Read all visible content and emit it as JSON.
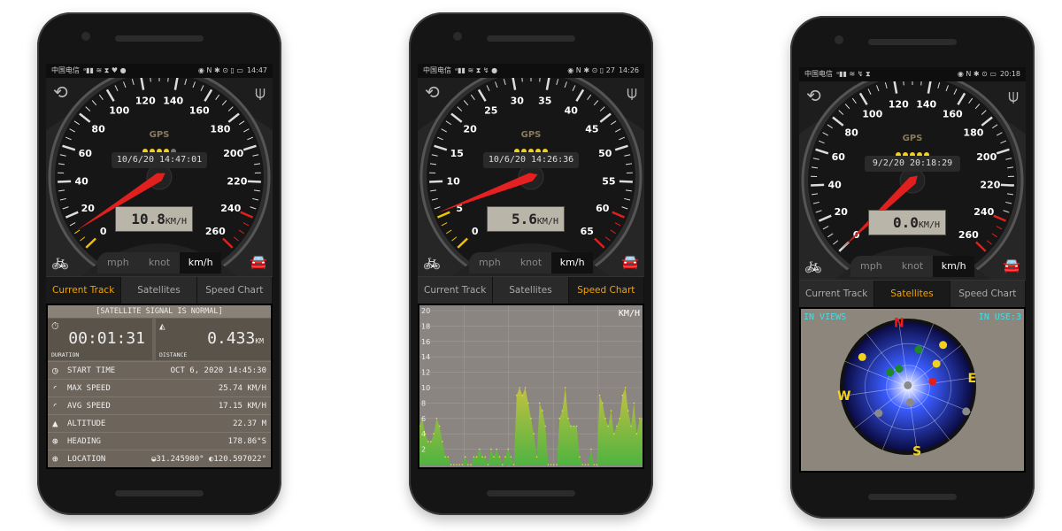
{
  "colors": {
    "accent": "#f2a400",
    "needle": "#e0201f",
    "car": "#9bd81c",
    "lcd": "#b9b5a9"
  },
  "phones": [
    {
      "status": {
        "carrier": "中国电信",
        "icons_left": "ᵃ▮▮ ≋ ⧗ ♥ ●",
        "icons_right": "◉ N ✱ ⊙ ▯ ▭",
        "time": "14:47"
      },
      "gauge": {
        "max": 260,
        "step": 20,
        "ticks": [
          "0",
          "20",
          "40",
          "60",
          "80",
          "100",
          "120",
          "140",
          "160",
          "180",
          "200",
          "220",
          "240",
          "260"
        ],
        "red_from": 240,
        "yellow_to": 10,
        "value": 10.8,
        "gps_label": "GPS",
        "gps_bars": 4,
        "date": "10/6/20 14:47:01",
        "speed": "10.8",
        "speed_unit": "KM/H",
        "units": [
          "mph",
          "knot",
          "km/h"
        ],
        "active_unit": 2
      },
      "tabs": [
        "Current Track",
        "Satellites",
        "Speed Chart"
      ],
      "active_tab": 0,
      "track": {
        "header": "[SATELLITE SIGNAL IS NORMAL]",
        "duration": "00:01:31",
        "duration_label": "DURATION",
        "distance": "0.433",
        "distance_unit": "KM",
        "distance_label": "DISTANCE",
        "rows": [
          {
            "icon": "clock-icon",
            "glyph": "◷",
            "label": "START TIME",
            "value": "OCT 6, 2020 14:45:30"
          },
          {
            "icon": "max-speed-icon",
            "glyph": "◜",
            "label": "MAX SPEED",
            "value": "25.74 KM/H"
          },
          {
            "icon": "avg-speed-icon",
            "glyph": "◜",
            "label": "AVG SPEED",
            "value": "17.15 KM/H"
          },
          {
            "icon": "altitude-icon",
            "glyph": "▲",
            "label": "ALTITUDE",
            "value": "22.37 M"
          },
          {
            "icon": "heading-icon",
            "glyph": "⊛",
            "label": "HEADING",
            "value": "178.86°S"
          },
          {
            "icon": "location-icon",
            "glyph": "⊕",
            "label": "LOCATION",
            "value": "◒31.245980° ◐120.597022°"
          }
        ]
      }
    },
    {
      "status": {
        "carrier": "中国电信",
        "icons_left": "ᵃ▮▮ ≋ ⧗ ↯ ●",
        "icons_right": "◉ N ✱ ⊙ ▯ 27",
        "time": "14:26"
      },
      "gauge": {
        "max": 65,
        "step": 5,
        "ticks": [
          "0",
          "5",
          "10",
          "15",
          "20",
          "25",
          "30",
          "35",
          "40",
          "45",
          "50",
          "55",
          "60",
          "65"
        ],
        "red_from": 60,
        "yellow_to": 5,
        "value": 5.6,
        "gps_label": "GPS",
        "gps_bars": 5,
        "date": "10/6/20 14:26:36",
        "speed": "5.6",
        "speed_unit": "KM/H",
        "units": [
          "mph",
          "knot",
          "km/h"
        ],
        "active_unit": 2
      },
      "tabs": [
        "Current Track",
        "Satellites",
        "Speed Chart"
      ],
      "active_tab": 2,
      "chart_data": {
        "type": "area",
        "ylabel": "KM/H",
        "ylim": [
          0,
          20
        ],
        "yticks": [
          "2",
          "4",
          "6",
          "8",
          "10",
          "12",
          "14",
          "16",
          "18",
          "20"
        ],
        "values": [
          5,
          6,
          4,
          3,
          3,
          4,
          6,
          5,
          3,
          1,
          1,
          0,
          0,
          0,
          0,
          0,
          1,
          0,
          0,
          1,
          1,
          2,
          1,
          1,
          0,
          2,
          1,
          2,
          1,
          0,
          1,
          2,
          1,
          0,
          9,
          10,
          9,
          10,
          8,
          6,
          4,
          1,
          8,
          7,
          5,
          0,
          0,
          0,
          0,
          6,
          7,
          10,
          6,
          5,
          5,
          5,
          1,
          0,
          0,
          0,
          2,
          0,
          0,
          9,
          8,
          6,
          5,
          7,
          4,
          5,
          6,
          9,
          10,
          7,
          5,
          8,
          4,
          6,
          6
        ]
      }
    },
    {
      "status": {
        "carrier": "中国电信",
        "icons_left": "ᵃ▮▮ ≋ ↯ ⧗",
        "icons_right": "◉ N ✱ ⊙ ▭",
        "time": "20:18"
      },
      "gauge": {
        "max": 260,
        "step": 20,
        "ticks": [
          "0",
          "20",
          "40",
          "60",
          "80",
          "100",
          "120",
          "140",
          "160",
          "180",
          "200",
          "220",
          "240",
          "260"
        ],
        "red_from": 240,
        "yellow_to": 0,
        "value": 0,
        "gps_label": "GPS",
        "gps_bars": 5,
        "date": "9/2/20 20:18:29",
        "speed": "0.0",
        "speed_unit": "KM/H",
        "units": [
          "mph",
          "knot",
          "km/h"
        ],
        "active_unit": 2
      },
      "tabs": [
        "Current Track",
        "Satellites",
        "Speed Chart"
      ],
      "active_tab": 1,
      "satellites": {
        "in_view": "IN VIEWS",
        "in_use": "IN USE:3",
        "compass": {
          "N": "N",
          "E": "E",
          "S": "S",
          "W": "W"
        },
        "list": [
          {
            "az": 311,
            "el": 14,
            "color": "#f2d21a"
          },
          {
            "az": 24,
            "el": 36,
            "color": "#1c8a2a"
          },
          {
            "az": 48,
            "el": 14,
            "color": "#f2d21a"
          },
          {
            "az": 317,
            "el": 58,
            "color": "#1c8a2a"
          },
          {
            "az": 342,
            "el": 62,
            "color": "#1c8a2a"
          },
          {
            "az": 59,
            "el": 39,
            "color": "#f2d21a"
          },
          {
            "az": 86,
            "el": 55,
            "color": "#e0201f"
          },
          {
            "az": 0,
            "el": 88,
            "color": "#8a8a8a"
          },
          {
            "az": 180,
            "el": 68,
            "color": "#8a8a8a"
          },
          {
            "az": 236,
            "el": 35,
            "color": "#8a8a8a"
          },
          {
            "az": 121,
            "el": 2,
            "color": "#8a8a8a"
          }
        ]
      }
    }
  ]
}
